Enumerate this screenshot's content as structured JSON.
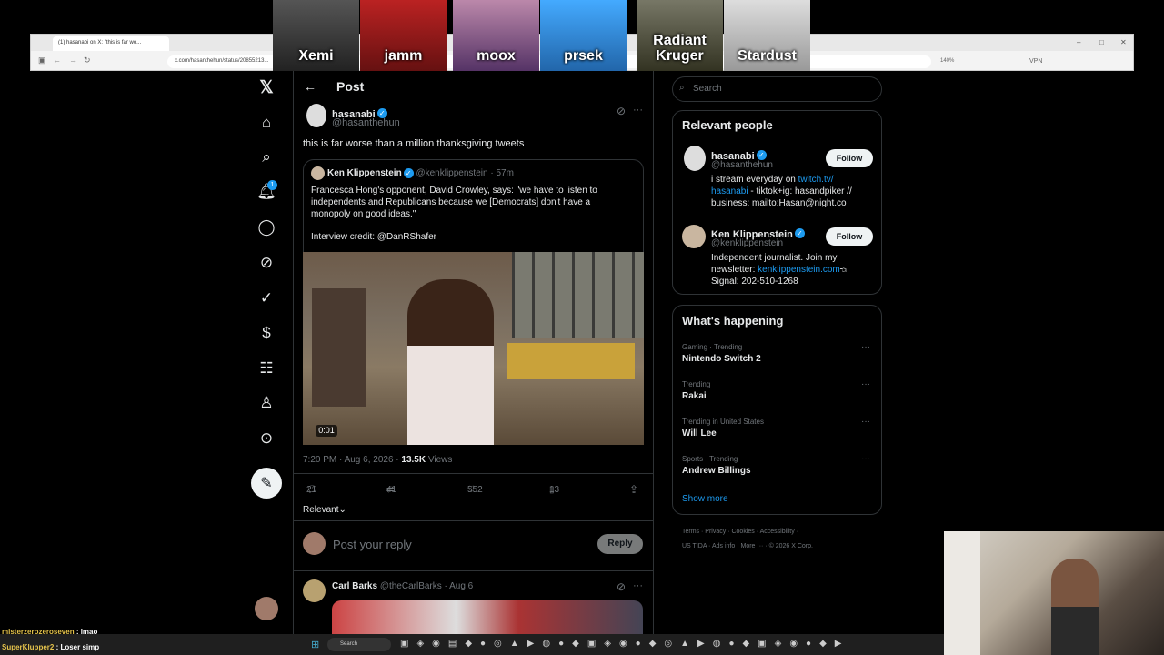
{
  "overlay": {
    "emotes": [
      "Xemi",
      "jamm",
      "moox",
      "prsek",
      "Radiant Kruger",
      "Stardust"
    ],
    "chat": [
      {
        "user": "misterzerozeroseven",
        "text": "lmao"
      },
      {
        "user": "SuperKlupper2",
        "text": "Loser simp"
      }
    ]
  },
  "browser": {
    "tab_title": "(1) hasanabi on X: \"this is far wo...",
    "url": "x.com/hasanthehun/status/20855213...",
    "zoom": "140%",
    "vpn": "VPN"
  },
  "nav": {
    "notification_count": "1"
  },
  "header": {
    "title": "Post"
  },
  "post": {
    "author_name": "hasanabi",
    "author_handle": "@hasanthehun",
    "text": "this is far worse than a million thanksgiving tweets",
    "quote": {
      "author_name": "Ken Klippenstein",
      "author_handle": "@kenklippenstein",
      "time": "· 57m",
      "text": "Francesca Hong's opponent, David Crowley, says: \"we have to listen to independents and Republicans because we [Democrats] don't have a monopoly on good ideas.\"",
      "credit": "Interview credit: @DanRShafer",
      "video_time": "0:01"
    },
    "timestamp": "7:20 PM · Aug 6, 2026 ·",
    "views_count": "13.5K",
    "views_label": "Views",
    "replies": "21",
    "reposts": "41",
    "likes": "552",
    "bookmarks": "13",
    "sort_label": "Relevant"
  },
  "reply_box": {
    "placeholder": "Post your reply",
    "button": "Reply"
  },
  "next_post": {
    "author_name": "Carl Barks",
    "author_handle": "@theCarlBarks",
    "date": "· Aug 6"
  },
  "sidebar": {
    "search_placeholder": "Search",
    "relevant_title": "Relevant people",
    "people": [
      {
        "name": "hasanabi",
        "handle": "@hasanthehun",
        "bio_prefix": "i stream everyday on ",
        "bio_link": "twitch.tv/",
        "bio_link2": "hasanabi",
        "bio_rest": " - tiktok+ig: hasandpiker //",
        "bio_line3": "business: mailto:Hasan@night.co",
        "follow": "Follow"
      },
      {
        "name": "Ken Klippenstein",
        "handle": "@kenklippenstein",
        "bio_line1": "Independent journalist. Join my",
        "bio_prefix2": "newsletter: ",
        "bio_link": "kenklippenstein.com",
        "bio_line3": "Signal: 202-510-1268",
        "follow": "Follow"
      }
    ],
    "happening_title": "What's happening",
    "trends": [
      {
        "meta": "Gaming · Trending",
        "name": "Nintendo Switch 2"
      },
      {
        "meta": "Trending",
        "name": "Rakai"
      },
      {
        "meta": "Trending in United States",
        "name": "Will Lee"
      },
      {
        "meta": "Sports · Trending",
        "name": "Andrew Billings"
      }
    ],
    "show_more": "Show more",
    "footer": {
      "terms": "Terms",
      "privacy": "Privacy",
      "cookies": "Cookies",
      "accessibility": "Accessibility",
      "ustida": "US TIDA",
      "ads": "Ads info",
      "more": "More ···",
      "copyright": "© 2026 X Corp."
    }
  },
  "taskbar": {
    "search": "Search"
  }
}
